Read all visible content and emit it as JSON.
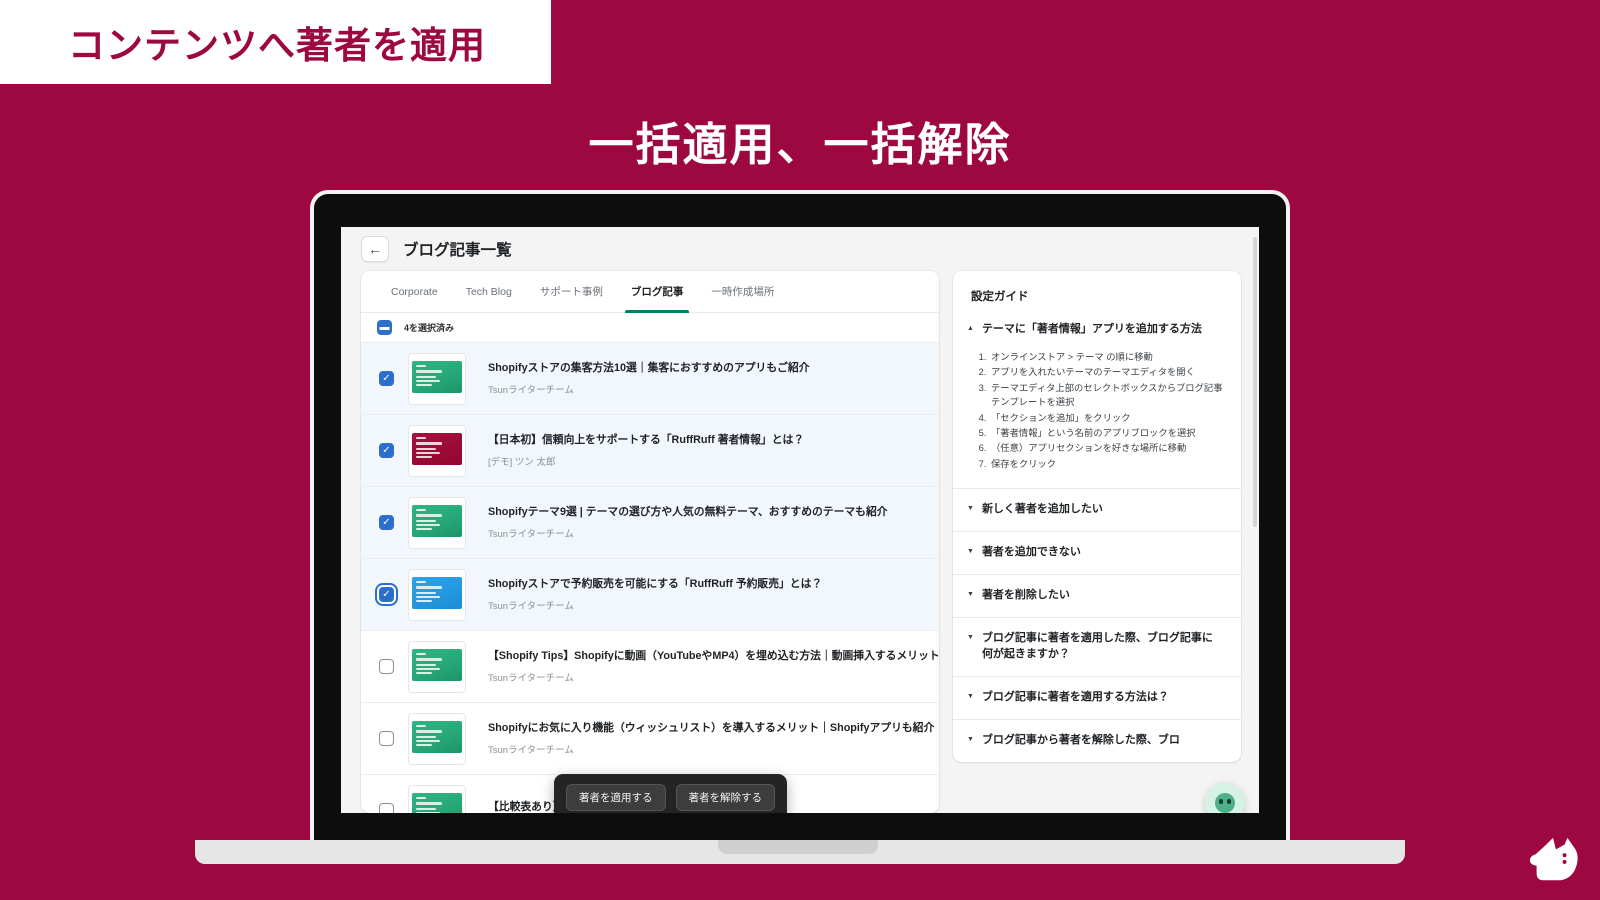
{
  "promo": {
    "badge": "コンテンツへ著者を適用",
    "title": "一括適用、一括解除"
  },
  "colors": {
    "brand_crimson": "#9d0840",
    "accent_green": "#008060",
    "checkbox_blue": "#2c6ecb",
    "selected_row": "#f2f7fe",
    "toolbar_dark": "#242424"
  },
  "app": {
    "back_icon": "arrow-left-icon",
    "title": "ブログ記事一覧"
  },
  "tabs": [
    {
      "label": "Corporate",
      "active": false
    },
    {
      "label": "Tech Blog",
      "active": false
    },
    {
      "label": "サポート事例",
      "active": false
    },
    {
      "label": "ブログ記事",
      "active": true
    },
    {
      "label": "一時作成場所",
      "active": false
    }
  ],
  "selection": {
    "checkbox_state": "indeterminate",
    "label": "4を選択済み"
  },
  "rows": [
    {
      "title": "Shopifyストアの集客方法10選｜集客におすすめのアプリもご紹介",
      "author": "Tsunライターチーム",
      "checked": true,
      "focused": false,
      "thumb": "green"
    },
    {
      "title": "【日本初】信頼向上をサポートする「RuffRuff 著者情報」とは？",
      "author": "[デモ] ツン 太郎",
      "checked": true,
      "focused": false,
      "thumb": "crimson"
    },
    {
      "title": "Shopifyテーマ9選 | テーマの選び方や人気の無料テーマ、おすすめのテーマも紹介",
      "author": "Tsunライターチーム",
      "checked": true,
      "focused": false,
      "thumb": "green"
    },
    {
      "title": "Shopifyストアで予約販売を可能にする「RuffRuff 予約販売」とは？",
      "author": "Tsunライターチーム",
      "checked": true,
      "focused": true,
      "thumb": "blue"
    },
    {
      "title": "【Shopify Tips】Shopifyに動画（YouTubeやMP4）を埋め込む方法｜動画挿入するメリット・",
      "author": "Tsunライターチーム",
      "checked": false,
      "focused": false,
      "thumb": "green"
    },
    {
      "title": "Shopifyにお気に入り機能（ウィッシュリスト）を導入するメリット｜Shopifyアプリも紹介",
      "author": "Tsunライターチーム",
      "checked": false,
      "focused": false,
      "thumb": "green"
    },
    {
      "title": "【比較表あり】Shopifyの新テーマとは？従来との違いも解説",
      "author": "",
      "checked": false,
      "focused": false,
      "thumb": "green"
    }
  ],
  "action_bar": {
    "apply_label": "著者を適用する",
    "remove_label": "著者を解除する"
  },
  "guide": {
    "title": "設定ガイド",
    "items": [
      {
        "label": "テーマに「著者情報」アプリを追加する方法",
        "expanded": true,
        "caret": "caret-up-icon",
        "steps": [
          "オンラインストア > テーマ の順に移動",
          "アプリを入れたいテーマのテーマエディタを開く",
          "テーマエディタ上部のセレクトボックスからブログ記事テンプレートを選択",
          "「セクションを追加」をクリック",
          "「著者情報」という名前のアプリブロックを選択",
          "（任意）アプリセクションを好きな場所に移動",
          "保存をクリック"
        ]
      },
      {
        "label": "新しく著者を追加したい",
        "expanded": false,
        "caret": "caret-down-icon",
        "steps": []
      },
      {
        "label": "著者を追加できない",
        "expanded": false,
        "caret": "caret-down-icon",
        "steps": []
      },
      {
        "label": "著者を削除したい",
        "expanded": false,
        "caret": "caret-down-icon",
        "steps": []
      },
      {
        "label": "ブログ記事に著者を適用した際、ブログ記事に何が起きますか？",
        "expanded": false,
        "caret": "caret-down-icon",
        "steps": []
      },
      {
        "label": "ブログ記事に著者を適用する方法は？",
        "expanded": false,
        "caret": "caret-down-icon",
        "steps": []
      },
      {
        "label": "ブログ記事から著者を解除した際、ブロ",
        "expanded": false,
        "caret": "caret-down-icon",
        "steps": []
      }
    ]
  },
  "chat_widget": {
    "icon": "chat-mascot-icon"
  },
  "brand": {
    "icon": "dog-head-logo-icon"
  }
}
